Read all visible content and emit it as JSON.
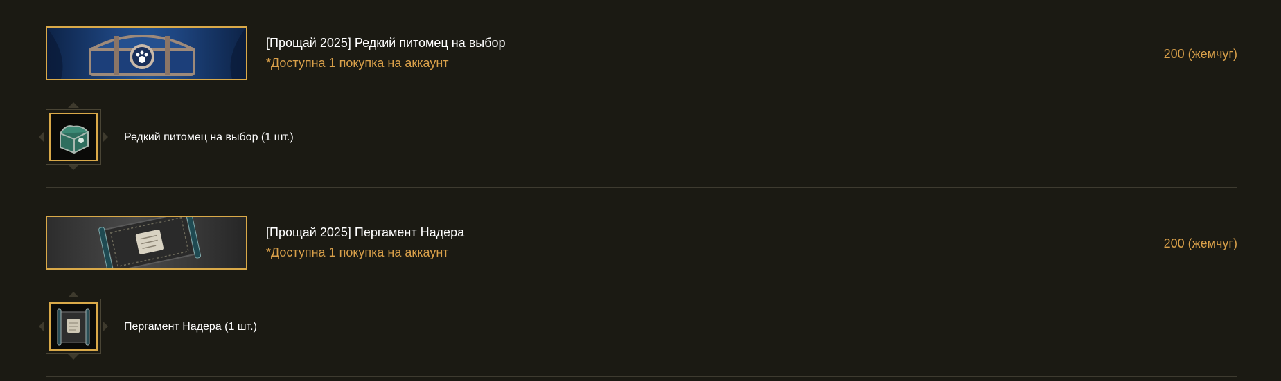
{
  "products": [
    {
      "title": "[Прощай 2025] Редкий питомец на выбор",
      "limit": "*Доступна 1 покупка на аккаунт",
      "price": "200 (жемчуг)",
      "item_label": "Редкий питомец на выбор (1 шт.)",
      "banner_icon": "blue-chest-with-paw",
      "item_icon": "green-chest"
    },
    {
      "title": "[Прощай 2025] Пергамент Надера",
      "limit": "*Доступна 1 покупка на аккаунт",
      "price": "200 (жемчуг)",
      "item_label": "Пергамент Надера (1 шт.)",
      "banner_icon": "parchment-scroll",
      "item_icon": "parchment-scroll"
    }
  ],
  "colors": {
    "background": "#1b1a13",
    "accent": "#d9a04a",
    "frame": "#d9a949",
    "text": "#ffffff"
  }
}
